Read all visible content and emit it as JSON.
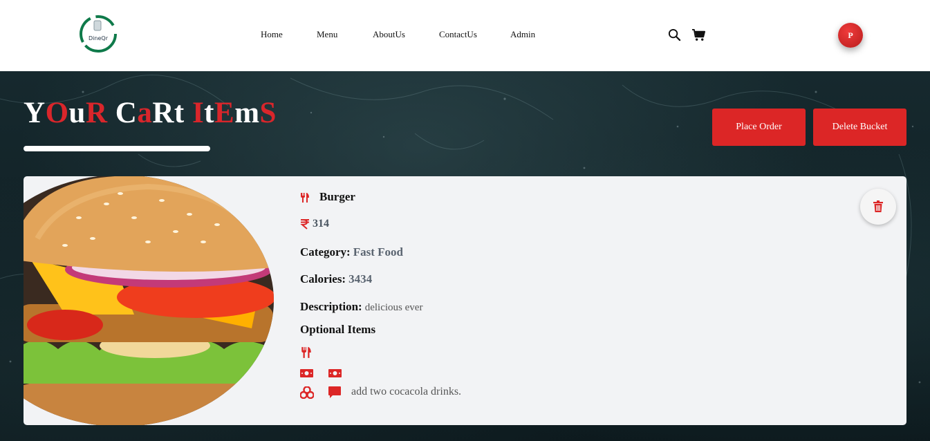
{
  "brand": {
    "logo_text": "DineQr",
    "accent": "#dc2626"
  },
  "nav": {
    "links": [
      "Home",
      "Menu",
      "AboutUs",
      "ContactUs",
      "Admin"
    ]
  },
  "header_icons": [
    "search-icon",
    "cart-icon"
  ],
  "user": {
    "avatar_initial": "P"
  },
  "page": {
    "title_parts": [
      {
        "t": "Y",
        "c": "w"
      },
      {
        "t": "O",
        "c": "r"
      },
      {
        "t": "u",
        "c": "w"
      },
      {
        "t": "R",
        "c": "r"
      },
      {
        "t": " ",
        "c": "w"
      },
      {
        "t": "C",
        "c": "w"
      },
      {
        "t": "a",
        "c": "r"
      },
      {
        "t": "Rt",
        "c": "w"
      },
      {
        "t": " ",
        "c": "w"
      },
      {
        "t": "I",
        "c": "r"
      },
      {
        "t": "t",
        "c": "w"
      },
      {
        "t": "E",
        "c": "r"
      },
      {
        "t": "m",
        "c": "w"
      },
      {
        "t": "S",
        "c": "r"
      }
    ],
    "place_order_label": "Place Order",
    "delete_bucket_label": "Delete Bucket"
  },
  "cart_item": {
    "name": "Burger",
    "price": "314",
    "category_label": "Category:",
    "category": "Fast Food",
    "calories_label": "Calories:",
    "calories": "3434",
    "description_label": "Description:",
    "description": "delicious ever",
    "optional_heading": "Optional Items",
    "instructions": "add two cocacola drinks.",
    "icons": [
      "utensils-icon",
      "rupee-icon",
      "money-icon",
      "cubes-icon",
      "comment-icon",
      "trash-icon"
    ]
  },
  "colors": {
    "accent_red": "#dc2626",
    "title_white": "#ffffff",
    "card_bg": "#f2f3f5"
  }
}
